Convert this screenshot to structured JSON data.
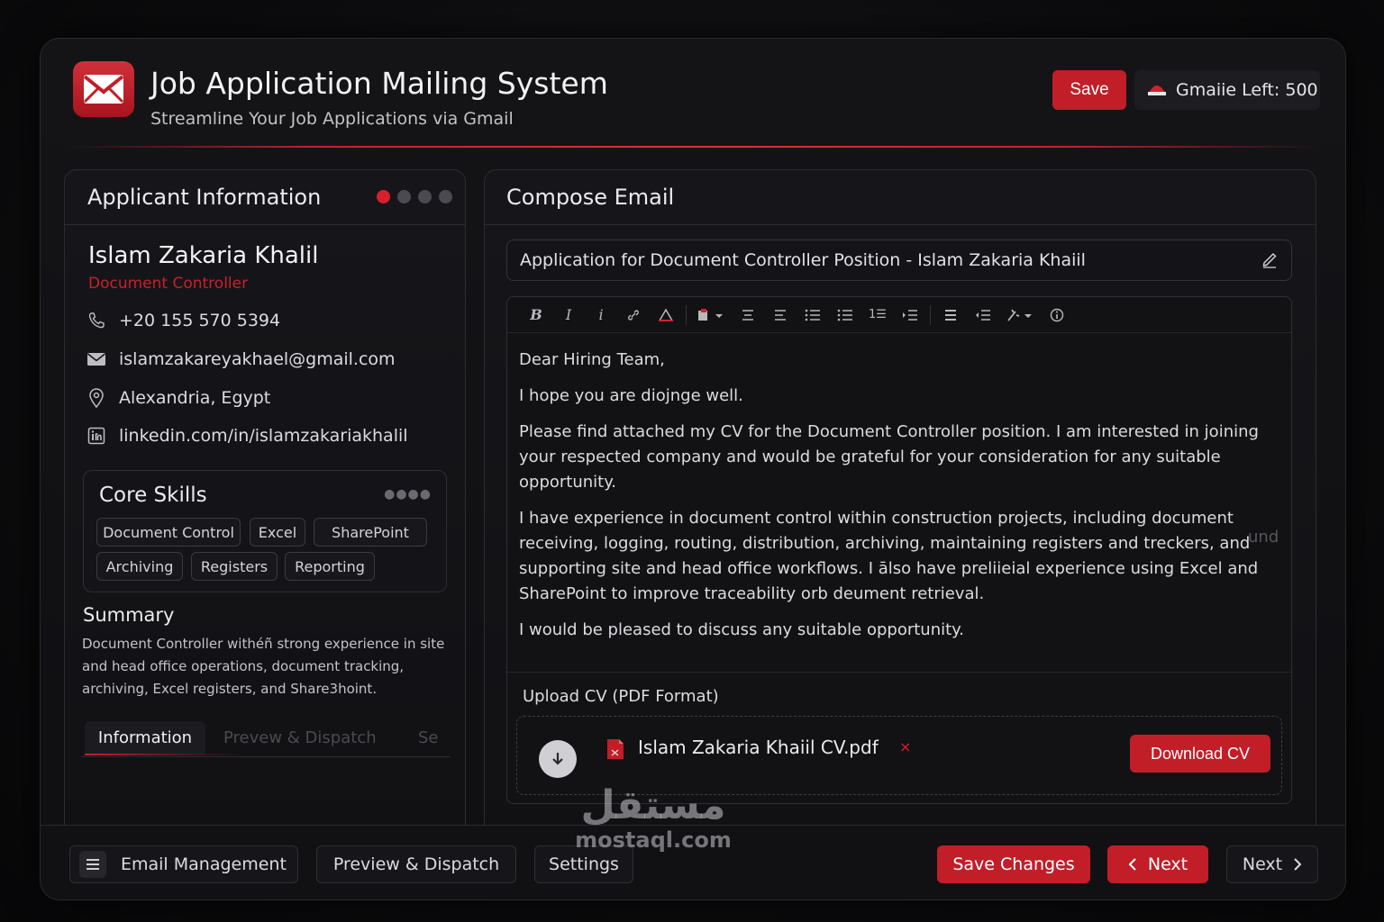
{
  "app": {
    "title": "Job Application Mailing System",
    "subtitle": "Streamline Your Job Applications via Gmail",
    "save_label": "Save",
    "gmail_left_label": "Gmaiie Left:",
    "gmail_left_count": "500",
    "accent_color": "#c21e28"
  },
  "applicant": {
    "panel_title": "Applicant Information",
    "name": "Islam Zakaria Khalil",
    "role": "Document Controller",
    "phone": "+20 155 570 5394",
    "email": "islamzakareyakhael@gmail.com",
    "location": "Alexandria, Egypt",
    "linkedin": "linkedin.com/in/islamzakariakhalil",
    "skills_title": "Core Skills",
    "skills": [
      "Document Control",
      "Excel",
      "SharePoint",
      "Archiving",
      "Registers",
      "Reporting"
    ],
    "summary_title": "Summary",
    "summary": "Document Controller withéñ strong experience in site and head office operations, document tracking, archiving, Excel registers, and Share3hoint.",
    "tabs": [
      "Information",
      "Prevew & Dispatch",
      "Se"
    ]
  },
  "compose": {
    "panel_title": "Compose Email",
    "subject": "Application for Document Controller Position - Islam Zakaria Khaiil",
    "body": [
      "Dear Hiring Team,",
      "I hope you are diojnge well.",
      "Please find attached my CV for the Document Controller position. I am interested in joining your respected company and would be grateful for your consideration for any suitable opportunity.",
      "I have experience in document control within construction projects, including document receiving, logging, routing, distribution, archiving, maintaining registers and treckers, and supporting site and head office workflows. I ālso have preliieial experience using Excel and SharePoint to improve traceability orb deument retrieval.",
      "I would be pleased to discuss any suitable opportunity."
    ],
    "body_fade_word": "und",
    "upload_label": "Upload CV (PDF Format)",
    "file_name": "Islam Zakaria Khaiil CV.pdf",
    "remove_mark": "×",
    "download_label": "Download CV"
  },
  "footer": {
    "email_management": "Email Management",
    "preview_dispatch": "Preview & Dispatch",
    "settings": "Settings",
    "save_changes": "Save Changes",
    "next_back": "Next",
    "next": "Next"
  },
  "watermark": {
    "arabic": "مستقل",
    "latin": "mostaql.com"
  }
}
